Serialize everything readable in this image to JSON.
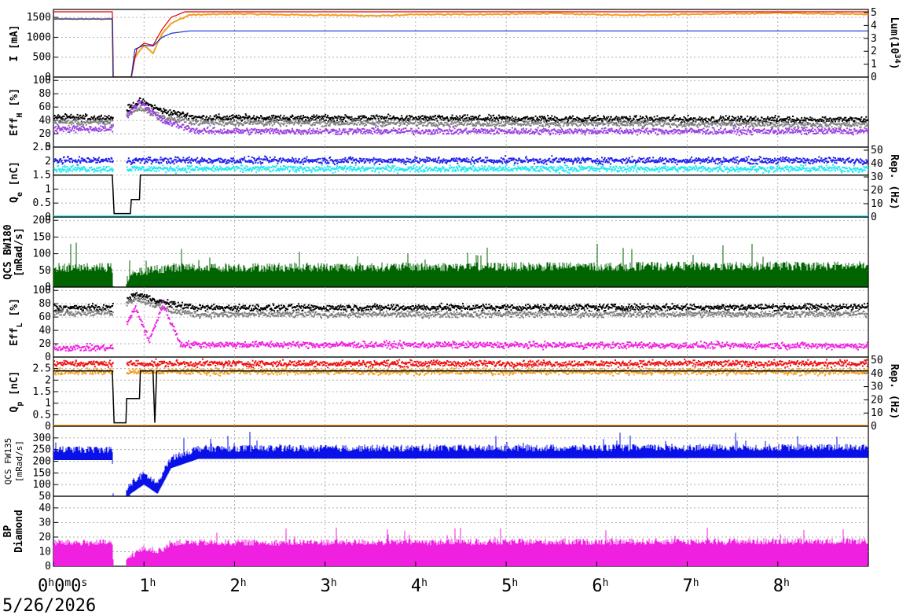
{
  "date": "5/26/2026",
  "x_ticks": [
    {
      "h": 0,
      "label": "0",
      "units": [
        "h",
        "m",
        "s"
      ],
      "extra": [
        "0",
        "0"
      ]
    },
    {
      "h": 1,
      "label": "1"
    },
    {
      "h": 2,
      "label": "2"
    },
    {
      "h": 3,
      "label": "3"
    },
    {
      "h": 4,
      "label": "4"
    },
    {
      "h": 5,
      "label": "5"
    },
    {
      "h": 6,
      "label": "6"
    },
    {
      "h": 7,
      "label": "7"
    },
    {
      "h": 8,
      "label": "8"
    }
  ],
  "hour_sup": "h",
  "colors": {
    "orange": "#f0a020",
    "red": "#e00000",
    "blue": "#1030d0",
    "black": "#000000",
    "gray": "#808080",
    "purple": "#9a40e0",
    "cyan": "#20e8f0",
    "navy": "#2020f0",
    "green": "#006400",
    "magenta": "#f020e0",
    "bright_red": "#f01010",
    "bright_blue": "#0a10e8"
  },
  "chart_data": [
    {
      "type": "line",
      "panel": "current",
      "ylabel": "I [mA]",
      "y2label_parts": [
        "Lum(10",
        "34",
        ")"
      ],
      "yticks": [
        "0",
        "500",
        "1000",
        "1500"
      ],
      "y2ticks": [
        "0",
        "1",
        "2",
        "3",
        "4",
        "5"
      ],
      "ylim": [
        0,
        1700
      ],
      "y2lim": [
        0,
        5
      ],
      "series": [
        {
          "color": "orange",
          "points": [
            [
              0,
              1460
            ],
            [
              0.65,
              1460
            ],
            [
              0.66,
              0
            ],
            [
              0.86,
              0
            ],
            [
              0.9,
              500
            ],
            [
              1.0,
              800
            ],
            [
              1.1,
              600
            ],
            [
              1.2,
              1100
            ],
            [
              1.3,
              1350
            ],
            [
              1.5,
              1560
            ],
            [
              2.0,
              1590
            ],
            [
              2.75,
              1560
            ],
            [
              3.0,
              1560
            ],
            [
              3.6,
              1540
            ],
            [
              4.0,
              1570
            ],
            [
              5.0,
              1580
            ],
            [
              5.5,
              1600
            ],
            [
              6.0,
              1570
            ],
            [
              6.5,
              1560
            ],
            [
              7.0,
              1580
            ],
            [
              7.5,
              1590
            ],
            [
              8.0,
              1610
            ],
            [
              9.0,
              1580
            ]
          ]
        },
        {
          "color": "red",
          "points": [
            [
              0,
              1640
            ],
            [
              0.65,
              1640
            ],
            [
              0.66,
              0
            ],
            [
              0.86,
              0
            ],
            [
              0.92,
              700
            ],
            [
              1.0,
              850
            ],
            [
              1.1,
              800
            ],
            [
              1.2,
              1200
            ],
            [
              1.3,
              1500
            ],
            [
              1.45,
              1640
            ],
            [
              9.0,
              1640
            ]
          ]
        },
        {
          "color": "blue",
          "points": [
            [
              0,
              1460
            ],
            [
              0.65,
              1460
            ],
            [
              0.66,
              0
            ],
            [
              0.86,
              0
            ],
            [
              0.9,
              700
            ],
            [
              1.0,
              800
            ],
            [
              1.1,
              780
            ],
            [
              1.2,
              1000
            ],
            [
              1.3,
              1100
            ],
            [
              1.5,
              1160
            ],
            [
              9.0,
              1160
            ]
          ]
        }
      ]
    },
    {
      "type": "scatter",
      "panel": "eff_h",
      "ylabel": "Eff",
      "ylabel_sub": "H",
      "ylabel_suffix": " [%]",
      "yticks": [
        "0",
        "20",
        "40",
        "60",
        "80",
        "100"
      ],
      "ylim": [
        0,
        105
      ],
      "series": [
        {
          "color": "black",
          "levels": [
            [
              0,
              45
            ],
            [
              0.65,
              45
            ],
            [
              0.95,
              70
            ],
            [
              1.2,
              55
            ],
            [
              1.6,
              45
            ],
            [
              9.0,
              42
            ]
          ]
        },
        {
          "color": "gray",
          "levels": [
            [
              0,
              38
            ],
            [
              0.65,
              38
            ],
            [
              0.95,
              60
            ],
            [
              1.2,
              45
            ],
            [
              1.6,
              38
            ],
            [
              9.0,
              35
            ]
          ]
        },
        {
          "color": "purple",
          "levels": [
            [
              0,
              28
            ],
            [
              0.65,
              28
            ],
            [
              0.95,
              70
            ],
            [
              1.2,
              40
            ],
            [
              1.6,
              25
            ],
            [
              9.0,
              25
            ]
          ]
        }
      ]
    },
    {
      "type": "scatter",
      "panel": "qe",
      "ylabel": "Q",
      "ylabel_sub": "e",
      "ylabel_suffix": " [nC]",
      "y2label": "Rep. (Hz)",
      "yticks": [
        "0",
        "0.5",
        "1",
        "1.5",
        "2",
        "2.5"
      ],
      "y2ticks": [
        "0",
        "10",
        "20",
        "30",
        "40",
        "50"
      ],
      "ylim": [
        0,
        2.5
      ],
      "series": [
        {
          "color": "navy",
          "levels": [
            [
              0,
              2.05
            ],
            [
              9.0,
              2.05
            ]
          ]
        },
        {
          "color": "cyan",
          "levels": [
            [
              0,
              1.75
            ],
            [
              9.0,
              1.75
            ]
          ]
        }
      ],
      "rep_line": [
        [
          0,
          0.6
        ],
        [
          0.65,
          0.6
        ],
        [
          0.67,
          0.05
        ],
        [
          0.85,
          0.05
        ],
        [
          0.86,
          0.25
        ],
        [
          0.95,
          0.25
        ],
        [
          0.96,
          0.6
        ],
        [
          9.0,
          0.6
        ]
      ]
    },
    {
      "type": "area",
      "panel": "qcs_bw",
      "ylabel_lines": [
        "QCS BW180",
        "[mRad/s]"
      ],
      "yticks": [
        "0",
        "50",
        "100",
        "150",
        "200"
      ],
      "ylim": [
        0,
        210
      ],
      "series": [
        {
          "color": "green",
          "base": 45,
          "spread": 55,
          "levels": [
            [
              0,
              45
            ],
            [
              0.65,
              45
            ],
            [
              0.66,
              0
            ],
            [
              0.8,
              0
            ],
            [
              0.85,
              20
            ],
            [
              1.0,
              35
            ],
            [
              1.3,
              45
            ],
            [
              9.0,
              50
            ]
          ]
        }
      ]
    },
    {
      "type": "scatter",
      "panel": "eff_l",
      "ylabel": "Eff",
      "ylabel_sub": "L",
      "ylabel_suffix": " [%]",
      "yticks": [
        "0",
        "20",
        "40",
        "60",
        "80",
        "100"
      ],
      "ylim": [
        0,
        105
      ],
      "series": [
        {
          "color": "black",
          "levels": [
            [
              0,
              75
            ],
            [
              0.65,
              75
            ],
            [
              0.9,
              95
            ],
            [
              1.3,
              80
            ],
            [
              1.6,
              75
            ],
            [
              9.0,
              76
            ]
          ]
        },
        {
          "color": "gray",
          "levels": [
            [
              0,
              68
            ],
            [
              0.65,
              68
            ],
            [
              0.9,
              90
            ],
            [
              1.3,
              70
            ],
            [
              1.6,
              65
            ],
            [
              9.0,
              66
            ]
          ]
        },
        {
          "color": "magenta",
          "levels": [
            [
              0,
              15
            ],
            [
              0.65,
              15
            ],
            [
              0.9,
              75
            ],
            [
              1.05,
              25
            ],
            [
              1.2,
              80
            ],
            [
              1.4,
              20
            ],
            [
              9.0,
              18
            ]
          ]
        }
      ]
    },
    {
      "type": "scatter",
      "panel": "qp",
      "ylabel": "Q",
      "ylabel_sub": "p",
      "ylabel_suffix": " [nC]",
      "y2label": "Rep. (Hz)",
      "yticks": [
        "0",
        "0.5",
        "1",
        "1.5",
        "2",
        "2.5"
      ],
      "y2ticks": [
        "0",
        "10",
        "20",
        "30",
        "40",
        "50"
      ],
      "ylim": [
        0,
        3
      ],
      "series": [
        {
          "color": "bright_red",
          "levels": [
            [
              0,
              2.75
            ],
            [
              9.0,
              2.75
            ]
          ]
        },
        {
          "color": "orange",
          "levels": [
            [
              0,
              2.4
            ],
            [
              9.0,
              2.4
            ]
          ]
        }
      ],
      "rep_line": [
        [
          0,
          0.8
        ],
        [
          0.65,
          0.8
        ],
        [
          0.67,
          0.05
        ],
        [
          0.8,
          0.05
        ],
        [
          0.81,
          0.4
        ],
        [
          0.95,
          0.4
        ],
        [
          0.96,
          0.8
        ],
        [
          1.1,
          0.8
        ],
        [
          1.12,
          0.05
        ],
        [
          1.14,
          0.8
        ],
        [
          9.0,
          0.8
        ]
      ]
    },
    {
      "type": "area",
      "panel": "qcs_fw",
      "ylabel_lines": [
        "QCS FW135",
        "[mRad/s]"
      ],
      "yticks": [
        "50",
        "100",
        "150",
        "200",
        "250",
        "300"
      ],
      "ylim": [
        50,
        350
      ],
      "series": [
        {
          "color": "bright_blue",
          "base": 235,
          "spread": 60,
          "levels": [
            [
              0,
              235
            ],
            [
              0.65,
              235
            ],
            [
              0.66,
              50
            ],
            [
              0.8,
              50
            ],
            [
              0.85,
              90
            ],
            [
              1.0,
              130
            ],
            [
              1.15,
              90
            ],
            [
              1.3,
              200
            ],
            [
              1.6,
              240
            ],
            [
              9.0,
              245
            ]
          ]
        }
      ]
    },
    {
      "type": "area",
      "panel": "bp",
      "ylabel_lines": [
        "BP",
        "Diamond"
      ],
      "yticks": [
        "0",
        "10",
        "20",
        "30",
        "40"
      ],
      "ylim": [
        0,
        48
      ],
      "series": [
        {
          "color": "magenta",
          "base": 14,
          "spread": 9,
          "levels": [
            [
              0,
              14
            ],
            [
              0.65,
              14
            ],
            [
              0.66,
              0
            ],
            [
              0.8,
              0
            ],
            [
              0.85,
              5
            ],
            [
              1.0,
              10
            ],
            [
              1.2,
              8
            ],
            [
              1.3,
              14
            ],
            [
              9.0,
              15
            ]
          ]
        }
      ]
    }
  ]
}
